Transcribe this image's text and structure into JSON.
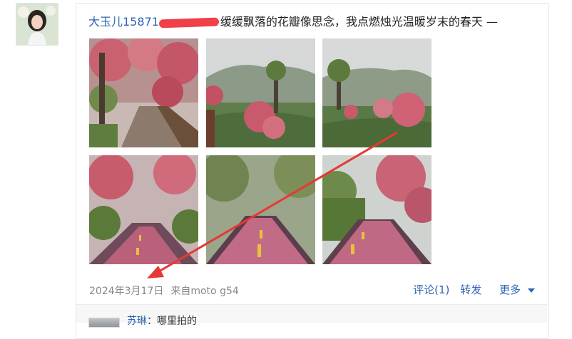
{
  "post": {
    "username": "大玉儿15871",
    "text": "缓缓飘落的花瓣像思念，我点燃烛光温暖岁末的春天 —",
    "date": "2024年3月17日",
    "source": "来自moto g54"
  },
  "actions": {
    "comment": "评论(1)",
    "repost": "转发",
    "more": "更多"
  },
  "comment": {
    "user": "苏琳",
    "text": "：哪里拍的"
  },
  "colors": {
    "link": "#2d64b3",
    "annotation_arrow": "#e53935",
    "redaction": "#f0404a"
  },
  "photos": [
    {
      "subject": "blossom-boardwalk"
    },
    {
      "subject": "blossom-hills"
    },
    {
      "subject": "tea-field-blossoms"
    },
    {
      "subject": "blossom-road"
    },
    {
      "subject": "petal-road-center"
    },
    {
      "subject": "petal-road-curve"
    }
  ]
}
